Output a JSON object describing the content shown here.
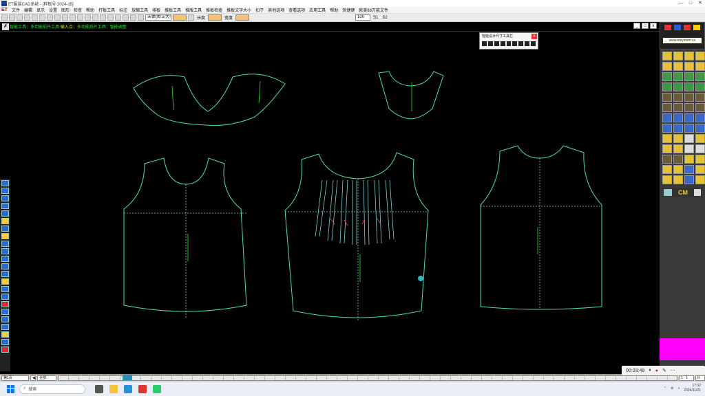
{
  "window": {
    "title": "ET服装CAD系统 - [样板号 2024-15]",
    "min": "—",
    "max": "□",
    "close": "✕"
  },
  "menu": {
    "logo": "ET",
    "items": [
      "文件",
      "编辑",
      "显示",
      "设置",
      "图形",
      "检查",
      "帮助",
      "打板工具",
      "标注",
      "放缩工具",
      "排板",
      "推板工具",
      "推版工具",
      "推板检查",
      "推板文字大小",
      "扣子",
      "其他选项",
      "查看选项",
      "应用工具",
      "帮助",
      "快捷键",
      "欧美88万能文件"
    ]
  },
  "toolbar": {
    "font_select": "宋体(默认大小)",
    "size_label": "长度",
    "width_label": "宽度",
    "scale_value": "100",
    "s1_label": "S1",
    "s2_label": "S2"
  },
  "hint": {
    "prefix": "智能工具：",
    "text": "多功能前片工具",
    "mid": "输入点：",
    "text2": "多功能后片工具",
    "suffix": "：智能调整"
  },
  "floating_panel": {
    "title": "智能设计尺寸工具栏"
  },
  "right_panel": {
    "brand": "www.etsystem.cn",
    "cm_label": "CM"
  },
  "bottom": {
    "sheet_label": "第1页",
    "all_label": "全部",
    "zoom": "1 : 1",
    "page_value": "H"
  },
  "recorder": {
    "time": "00:03:49"
  },
  "taskbar": {
    "search_placeholder": "搜索",
    "time": "17:32",
    "date": "2024/11/21"
  },
  "colors": {
    "pattern_line": "#4fe0a0",
    "seam_line": "#7fd8d8",
    "grain_line": "#2ee62e",
    "pleat_mark": "#e23a3a",
    "accent": "#ff00ff"
  }
}
